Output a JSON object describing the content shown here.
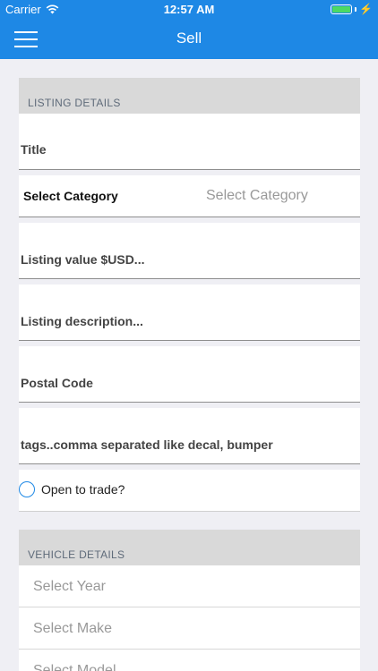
{
  "status_bar": {
    "carrier": "Carrier",
    "time": "12:57 AM",
    "wifi_icon": "wifi-icon",
    "battery_icon": "battery-icon",
    "charging_icon": "charging-bolt-icon",
    "battery_level": 1.0
  },
  "nav": {
    "title": "Sell",
    "menu_icon": "hamburger-menu-icon"
  },
  "listing_details": {
    "header": "LISTING DETAILS",
    "title_placeholder": "Title",
    "category_label": "Select Category",
    "category_value": "Select Category",
    "value_placeholder": "Listing value $USD...",
    "description_placeholder": "Listing description...",
    "postal_placeholder": "Postal Code",
    "tags_placeholder": "tags..comma separated like decal, bumper",
    "trade_label": "Open to trade?",
    "trade_checked": false
  },
  "vehicle_details": {
    "header": "VEHICLE DETAILS",
    "year_placeholder": "Select Year",
    "make_placeholder": "Select Make",
    "model_placeholder": "Select Model"
  },
  "colors": {
    "accent": "#1e88e5",
    "section_header_bg": "#d9d9d9",
    "background": "#efeff4"
  }
}
